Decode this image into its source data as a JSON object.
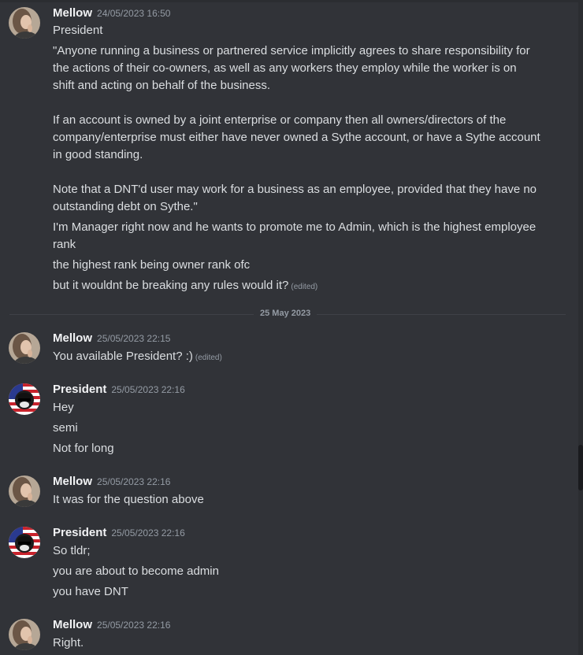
{
  "messages": [
    {
      "user": "Mellow",
      "time": "24/05/2023 16:50",
      "lines": [
        "President",
        "\"Anyone running a business or partnered service implicitly agrees to share responsibility for the actions of their co-owners, as well as any workers they employ while the worker is on shift and acting on behalf of the business.",
        "If an account is owned by a joint enterprise or company then all owners/directors of the company/enterprise must either have never owned a Sythe account, or have a Sythe account in good standing.",
        "Note that a DNT'd user may work for a business as an employee, provided that they have no outstanding debt on Sythe.\"",
        "I'm Manager right now and he wants to promote me to Admin, which is the highest employee rank",
        "the highest rank being owner rank ofc",
        "but it wouldnt be breaking any rules would it?"
      ]
    },
    {
      "user": "Mellow",
      "time": "25/05/2023 22:15",
      "lines": [
        "You available President? :)"
      ]
    },
    {
      "user": "President",
      "time": "25/05/2023 22:16",
      "lines": [
        "Hey",
        "semi",
        "Not for long"
      ]
    },
    {
      "user": "Mellow",
      "time": "25/05/2023 22:16",
      "lines": [
        "It was for the question above"
      ]
    },
    {
      "user": "President",
      "time": "25/05/2023 22:16",
      "lines": [
        "So tldr;",
        "you are about to become admin",
        "you have DNT"
      ]
    },
    {
      "user": "Mellow",
      "time": "25/05/2023 22:16",
      "lines": [
        "Right."
      ]
    }
  ],
  "edited_label": "(edited)",
  "date_divider": "25 May 2023",
  "colors": {
    "background": "#313338",
    "username": "#f2f3f5",
    "timestamp": "#949ba4",
    "text": "#dbdee1"
  },
  "icons": {
    "mellow_avatar": "mellow-avatar-icon",
    "president_avatar": "president-avatar-icon"
  }
}
